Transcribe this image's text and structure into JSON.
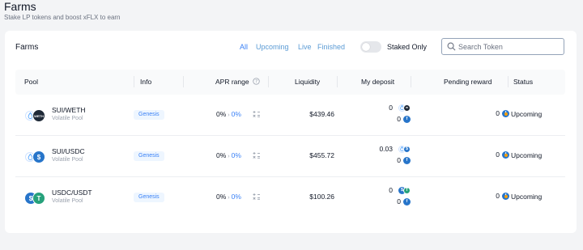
{
  "page": {
    "title": "Farms",
    "subtitle": "Stake LP tokens and boost xFLX to earn"
  },
  "card": {
    "title": "Farms",
    "filters": [
      "All",
      "Upcoming",
      "Live",
      "Finished"
    ],
    "active_filter": "All",
    "staked_only_label": "Staked Only",
    "staked_only": false,
    "search_placeholder": "Search Token"
  },
  "table": {
    "headers": {
      "pool": "Pool",
      "info": "Info",
      "apr": "APR range",
      "liquidity": "Liquidity",
      "deposit": "My deposit",
      "pending": "Pending reward",
      "status": "Status"
    },
    "rows": [
      {
        "pool": "SUI/WETH",
        "type": "Volatile Pool",
        "info": "Genesis",
        "apr_base": "0%",
        "apr_boost": "0%",
        "liquidity": "$439.46",
        "deposit_a": "0",
        "deposit_b": "0",
        "pending": "0",
        "status": "Upcoming",
        "token_a": "sui-icon",
        "token_b": "weth-icon"
      },
      {
        "pool": "SUI/USDC",
        "type": "Volatile Pool",
        "info": "Genesis",
        "apr_base": "0%",
        "apr_boost": "0%",
        "liquidity": "$455.72",
        "deposit_a": "0.03",
        "deposit_b": "0",
        "pending": "0",
        "status": "Upcoming",
        "token_a": "sui-icon",
        "token_b": "usdc-icon"
      },
      {
        "pool": "USDC/USDT",
        "type": "Volatile Pool",
        "info": "Genesis",
        "apr_base": "0%",
        "apr_boost": "0%",
        "liquidity": "$100.26",
        "deposit_a": "0",
        "deposit_b": "0",
        "pending": "0",
        "status": "Upcoming",
        "token_a": "usdc-icon",
        "token_b": "usdt-icon"
      }
    ]
  },
  "colors": {
    "accent": "#3b82f6",
    "status_upcoming": "#f59e0b",
    "sui": "#4da2ff",
    "usdc": "#2775ca",
    "usdt": "#26a17b",
    "weth": "#1f2937"
  }
}
